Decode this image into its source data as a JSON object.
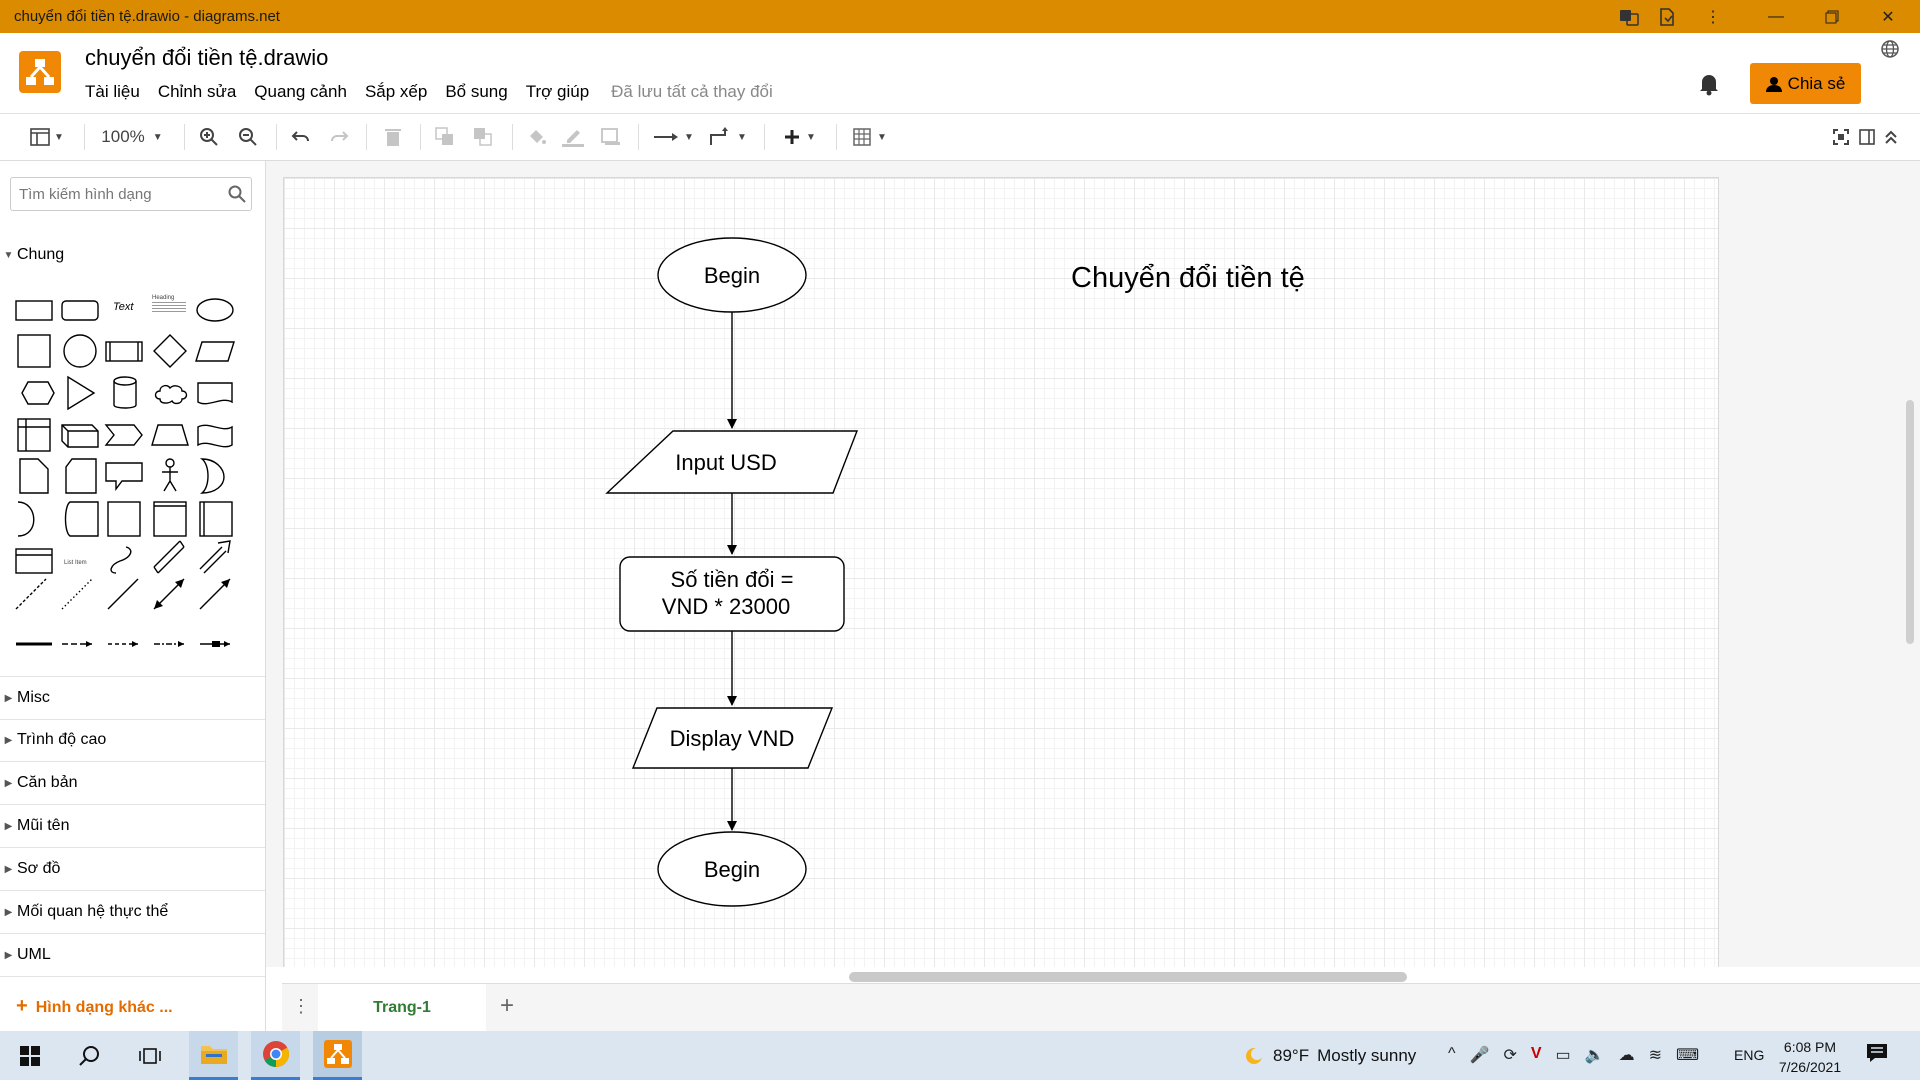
{
  "window": {
    "title": "chuyển đổi tiền tệ.drawio - diagrams.net"
  },
  "header": {
    "file_name": "chuyển đổi tiền tệ.drawio",
    "menu": [
      "Tài liệu",
      "Chỉnh sửa",
      "Quang cảnh",
      "Sắp xếp",
      "Bổ sung",
      "Trợ giúp"
    ],
    "save_status": "Đã lưu tất cả thay đổi",
    "share_label": "Chia sẻ"
  },
  "toolbar": {
    "zoom": "100%"
  },
  "sidebar": {
    "search_placeholder": "Tìm kiếm hình dạng",
    "general_section": "Chung",
    "shape_text_label": "Text",
    "shape_heading_label": "Heading",
    "shape_list_item_label": "List Item",
    "sections": [
      "Misc",
      "Trình độ cao",
      "Căn bản",
      "Mũi tên",
      "Sơ đồ",
      "Mối quan hệ thực thể",
      "UML"
    ],
    "more_shapes": "Hình dạng khác ..."
  },
  "diagram": {
    "title": "Chuyển đổi tiền tệ",
    "nodes": [
      {
        "shape": "ellipse",
        "text": "Begin"
      },
      {
        "shape": "parallelogram",
        "text": "Input USD"
      },
      {
        "shape": "rounded-rect",
        "line1": "Số tiền đổi =",
        "line2": "VND * 23000"
      },
      {
        "shape": "parallelogram",
        "text": "Display VND"
      },
      {
        "shape": "ellipse",
        "text": "Begin"
      }
    ]
  },
  "pages": {
    "tab1": "Trang-1"
  },
  "taskbar": {
    "weather_temp": "89°F",
    "weather_text": "Mostly sunny",
    "language": "ENG",
    "time": "6:08 PM",
    "date": "7/26/2021"
  },
  "colors": {
    "titlebar": "#da8b00",
    "accent": "#f08705",
    "active_tab_text": "#2e7d32",
    "taskbar": "#dbe6f1"
  }
}
